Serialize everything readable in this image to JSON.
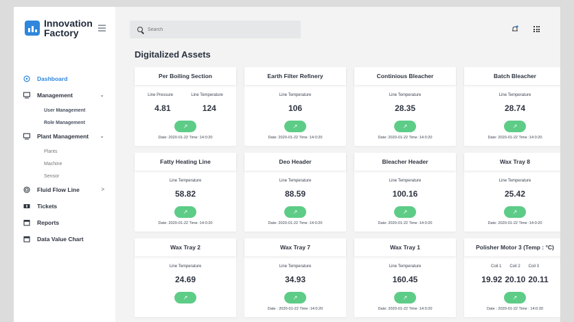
{
  "brand": {
    "name_line1": "Innovation",
    "name_line2": "Factory",
    "accent": "#2f86dc"
  },
  "search": {
    "placeholder": "Search"
  },
  "page": {
    "title": "Digitalized Assets"
  },
  "nav": {
    "dashboard": "Dashboard",
    "management": "Management",
    "user_management": "User Management",
    "role_management": "Role Management",
    "plant_management": "Plant Management",
    "plants": "Plants",
    "machine": "Machine",
    "sensor": "Sensor",
    "fluid_flow_line": "Fluid Flow Line",
    "tickets": "Tickets",
    "reports": "Reports",
    "data_value_chart": "Data Value Chart",
    "caret_down": "⌄",
    "caret_right": ">"
  },
  "arrow_glyph": "↗",
  "cards": [
    {
      "title": "Per Boiling Section",
      "labels": [
        "Line Pressure",
        "Line Temperature"
      ],
      "values": [
        "4.81",
        "124"
      ],
      "date": "Date: 2020-01-22 Time :14:0:20"
    },
    {
      "title": "Earth Filter Refinery",
      "labels": [
        "Line Temperature"
      ],
      "values": [
        "106"
      ],
      "date": "Date: 2020-01-22 Time :14:0:20"
    },
    {
      "title": "Continious Bleacher",
      "labels": [
        "Line Temperature"
      ],
      "values": [
        "28.35"
      ],
      "date": "Date: 2020-01-22 Time :14:0:20"
    },
    {
      "title": "Batch Bleacher",
      "labels": [
        "Line Temperature"
      ],
      "values": [
        "28.74"
      ],
      "date": "Date: 2020-01-22 Time :14:0:20"
    },
    {
      "title": "Fatty Heating Line",
      "labels": [
        "Line Temperature"
      ],
      "values": [
        "58.82"
      ],
      "date": "Date: 2020-01-22 Time :14:0:20"
    },
    {
      "title": "Deo Header",
      "labels": [
        "Line Temperature"
      ],
      "values": [
        "88.59"
      ],
      "date": "Date: 2020-01-22 Time :14:0:20"
    },
    {
      "title": "Bleacher Header",
      "labels": [
        "Line Temperature"
      ],
      "values": [
        "100.16"
      ],
      "date": "Date: 2020-01-22 Time :14:0:20"
    },
    {
      "title": "Wax Tray 8",
      "labels": [
        "Line Temperature"
      ],
      "values": [
        "25.42"
      ],
      "date": "Date: 2020-01-22 Time :14:0:20"
    },
    {
      "title": "Wax Tray 2",
      "labels": [
        "Line Temperature"
      ],
      "values": [
        "24.69"
      ],
      "date": ""
    },
    {
      "title": "Wax Tray 7",
      "labels": [
        "Line Temperature"
      ],
      "values": [
        "34.93"
      ],
      "date": "Date : 2020-01-22 Time :14:0:20"
    },
    {
      "title": "Wax Tray 1",
      "labels": [
        "Line Temperature"
      ],
      "values": [
        "160.45"
      ],
      "date": "Date: 2020-01-22 Time :14:0:20"
    },
    {
      "title": "Polisher Motor 3 (Temp : °C)",
      "labels": [
        "Coil 1",
        "Coil 2",
        "Coil 3"
      ],
      "values": [
        "19.92",
        "20.10",
        "20.11"
      ],
      "date": "Date : 2020-01-22 Time : 14:0:20"
    }
  ]
}
